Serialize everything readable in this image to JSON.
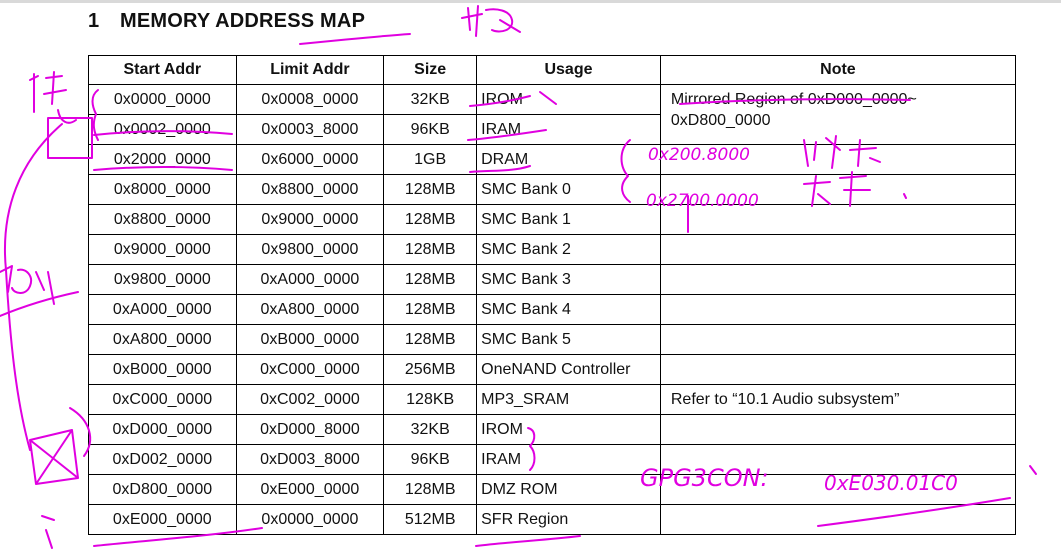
{
  "heading": {
    "number": "1",
    "title": "MEMORY ADDRESS MAP"
  },
  "table": {
    "columns": [
      "Start Addr",
      "Limit Addr",
      "Size",
      "Usage",
      "Note"
    ],
    "rows": [
      {
        "start": "0x0000_0000",
        "limit": "0x0008_0000",
        "size": "32KB",
        "usage": "IROM"
      },
      {
        "start": "0x0002_0000",
        "limit": "0x0003_8000",
        "size": "96KB",
        "usage": "IRAM"
      },
      {
        "start": "0x2000_0000",
        "limit": "0x6000_0000",
        "size": "1GB",
        "usage": "DRAM"
      },
      {
        "start": "0x8000_0000",
        "limit": "0x8800_0000",
        "size": "128MB",
        "usage": "SMC Bank 0"
      },
      {
        "start": "0x8800_0000",
        "limit": "0x9000_0000",
        "size": "128MB",
        "usage": "SMC Bank 1"
      },
      {
        "start": "0x9000_0000",
        "limit": "0x9800_0000",
        "size": "128MB",
        "usage": "SMC Bank 2"
      },
      {
        "start": "0x9800_0000",
        "limit": "0xA000_0000",
        "size": "128MB",
        "usage": "SMC Bank 3"
      },
      {
        "start": "0xA000_0000",
        "limit": "0xA800_0000",
        "size": "128MB",
        "usage": "SMC Bank 4"
      },
      {
        "start": "0xA800_0000",
        "limit": "0xB000_0000",
        "size": "128MB",
        "usage": "SMC Bank 5"
      },
      {
        "start": "0xB000_0000",
        "limit": "0xC000_0000",
        "size": "256MB",
        "usage": "OneNAND Controller"
      },
      {
        "start": "0xC000_0000",
        "limit": "0xC002_0000",
        "size": "128KB",
        "usage": "MP3_SRAM"
      },
      {
        "start": "0xD000_0000",
        "limit": "0xD000_8000",
        "size": "32KB",
        "usage": "IROM"
      },
      {
        "start": "0xD002_0000",
        "limit": "0xD003_8000",
        "size": "96KB",
        "usage": "IRAM"
      },
      {
        "start": "0xD800_0000",
        "limit": "0xE000_0000",
        "size": "128MB",
        "usage": "DMZ ROM"
      },
      {
        "start": "0xE000_0000",
        "limit": "0x0000_0000",
        "size": "512MB",
        "usage": "SFR Region"
      }
    ],
    "notes": {
      "mirrored_line1": "Mirrored Region of 0xD000_0000~",
      "mirrored_line2": "0xD800_0000",
      "audio_ref": "Refer to “10.1 Audio subsystem”"
    }
  },
  "annotations": {
    "dram_small": "0x200.8000",
    "dram_big": "0x2700.0000",
    "gpg": "GPG3CON:",
    "gpg_addr": "0xE030.01C0"
  },
  "colors": {
    "ink": "#e000e0",
    "grid": "#000000",
    "text": "#111111"
  }
}
